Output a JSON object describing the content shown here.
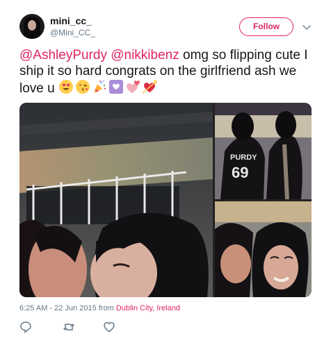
{
  "tweet": {
    "display_name": "mini_cc_",
    "handle": "@Mini_CC_",
    "follow_label": "Follow",
    "mention_1": "@AshleyPurdy",
    "mention_2": "@nikkibenz",
    "body": " omg so flipping cute I ship it so hard congrats on the girlfriend ash we love u ",
    "emojis": [
      "smiling-face-with-heart-eyes",
      "face-blowing-a-kiss",
      "party-popper",
      "heart-decoration",
      "revolving-hearts",
      "heart-with-arrow"
    ],
    "jersey_text": "PURDY",
    "jersey_number": "69",
    "time": "6:25 AM - 22 Jun 2015",
    "from_label": " from ",
    "place": "Dublin City, Ireland"
  },
  "actions": {
    "reply_icon": "reply-icon",
    "retweet_icon": "retweet-icon",
    "like_icon": "heart-icon"
  },
  "colors": {
    "accent": "#e0245e",
    "text": "#14171a",
    "muted": "#657786"
  }
}
